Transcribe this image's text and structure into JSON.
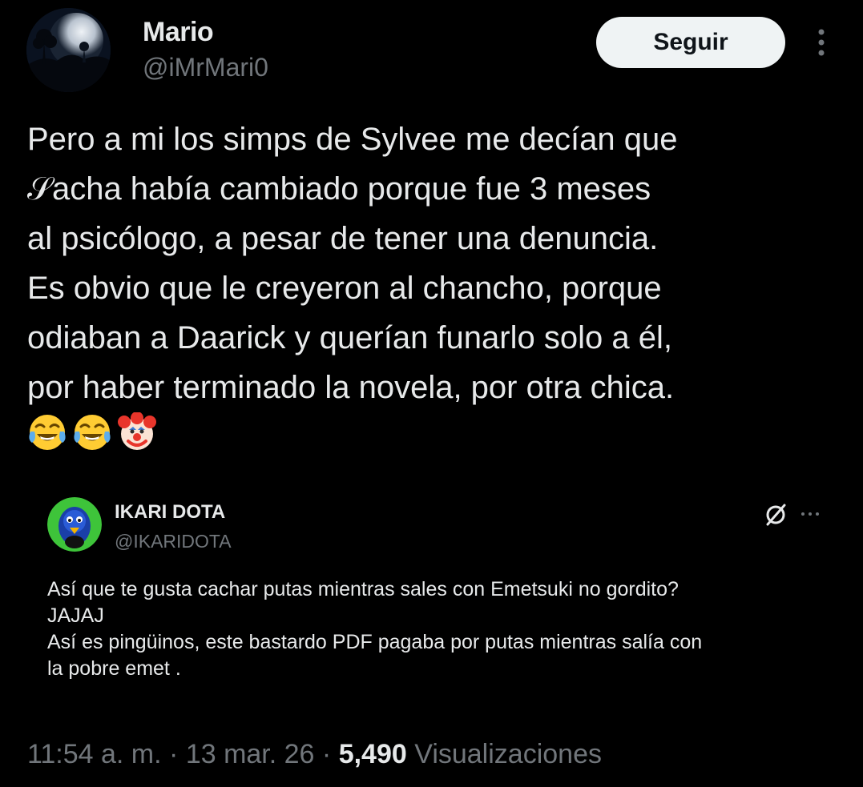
{
  "author": {
    "display_name": "Mario",
    "handle": "@iMrMari0"
  },
  "follow_button": {
    "label": "Seguir"
  },
  "tweet": {
    "text": "Pero a mi los simps de Sylvee me decían que\n𝒮acha había cambiado porque fue 3 meses\nal psicólogo, a pesar de tener una denuncia.\nEs obvio que le creyeron al chancho, porque\nodiaban a Daarick y querían funarlo solo a él,\npor haber terminado la novela, por otra chica.",
    "emojis": [
      "face-with-tears-of-joy-icon",
      "face-with-tears-of-joy-icon",
      "clown-face-icon"
    ]
  },
  "quote": {
    "display_name": "IKARI DOTA",
    "handle": "@IKARIDOTA",
    "text": "Así que te gusta cachar putas mientras sales con Emetsuki no gordito?\nJAJAJ\nAsí es pingüinos, este bastardo PDF pagaba por putas mientras salía con\nla pobre emet ."
  },
  "meta": {
    "time": "11:54 a. m.",
    "separator": "·",
    "date": "13 mar. 26",
    "views_count": "5,490",
    "views_label": "Visualizaciones"
  },
  "colors": {
    "background": "#000000",
    "text_primary": "#e7e9ea",
    "text_secondary": "#71767b",
    "follow_bg": "#eff3f4",
    "follow_text": "#0f1419"
  }
}
